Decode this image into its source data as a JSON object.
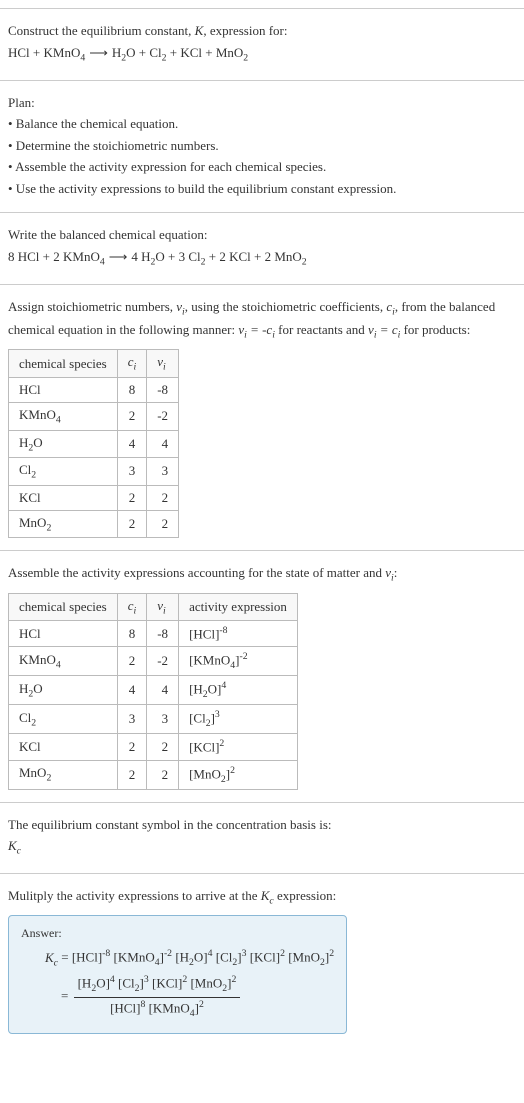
{
  "header": {
    "prompt": "Construct the equilibrium constant, ",
    "K": "K",
    "prompt2": ", expression for:",
    "equation_lhs": "HCl + KMnO",
    "equation_rhs": "H₂O + Cl₂ + KCl + MnO₂"
  },
  "plan": {
    "title": "Plan:",
    "items": [
      "• Balance the chemical equation.",
      "• Determine the stoichiometric numbers.",
      "• Assemble the activity expression for each chemical species.",
      "• Use the activity expressions to build the equilibrium constant expression."
    ]
  },
  "balanced": {
    "title": "Write the balanced chemical equation:",
    "equation": "8 HCl + 2 KMnO₄  ⟶  4 H₂O + 3 Cl₂ + 2 KCl + 2 MnO₂"
  },
  "stoich": {
    "intro1": "Assign stoichiometric numbers, ",
    "nu": "νᵢ",
    "intro2": ", using the stoichiometric coefficients, ",
    "ci": "cᵢ",
    "intro3": ", from the balanced chemical equation in the following manner: ",
    "rule1": "νᵢ = -cᵢ",
    "intro4": " for reactants and ",
    "rule2": "νᵢ = cᵢ",
    "intro5": " for products:",
    "headers": [
      "chemical species",
      "cᵢ",
      "νᵢ"
    ],
    "rows": [
      {
        "species": "HCl",
        "c": "8",
        "nu": "-8"
      },
      {
        "species": "KMnO₄",
        "c": "2",
        "nu": "-2"
      },
      {
        "species": "H₂O",
        "c": "4",
        "nu": "4"
      },
      {
        "species": "Cl₂",
        "c": "3",
        "nu": "3"
      },
      {
        "species": "KCl",
        "c": "2",
        "nu": "2"
      },
      {
        "species": "MnO₂",
        "c": "2",
        "nu": "2"
      }
    ]
  },
  "activity": {
    "intro": "Assemble the activity expressions accounting for the state of matter and νᵢ:",
    "headers": [
      "chemical species",
      "cᵢ",
      "νᵢ",
      "activity expression"
    ],
    "rows": [
      {
        "species": "HCl",
        "c": "8",
        "nu": "-8",
        "expr": "[HCl]⁻⁸"
      },
      {
        "species": "KMnO₄",
        "c": "2",
        "nu": "-2",
        "expr": "[KMnO₄]⁻²"
      },
      {
        "species": "H₂O",
        "c": "4",
        "nu": "4",
        "expr": "[H₂O]⁴"
      },
      {
        "species": "Cl₂",
        "c": "3",
        "nu": "3",
        "expr": "[Cl₂]³"
      },
      {
        "species": "KCl",
        "c": "2",
        "nu": "2",
        "expr": "[KCl]²"
      },
      {
        "species": "MnO₂",
        "c": "2",
        "nu": "2",
        "expr": "[MnO₂]²"
      }
    ]
  },
  "kc_symbol": {
    "line1": "The equilibrium constant symbol in the concentration basis is:",
    "line2": "K_c"
  },
  "final": {
    "intro": "Mulitply the activity expressions to arrive at the K_c expression:",
    "answer_label": "Answer:",
    "kc_eq": "K_c = [HCl]⁻⁸ [KMnO₄]⁻² [H₂O]⁴ [Cl₂]³ [KCl]² [MnO₂]²",
    "frac_num": "[H₂O]⁴ [Cl₂]³ [KCl]² [MnO₂]²",
    "frac_den": "[HCl]⁸ [KMnO₄]²"
  }
}
